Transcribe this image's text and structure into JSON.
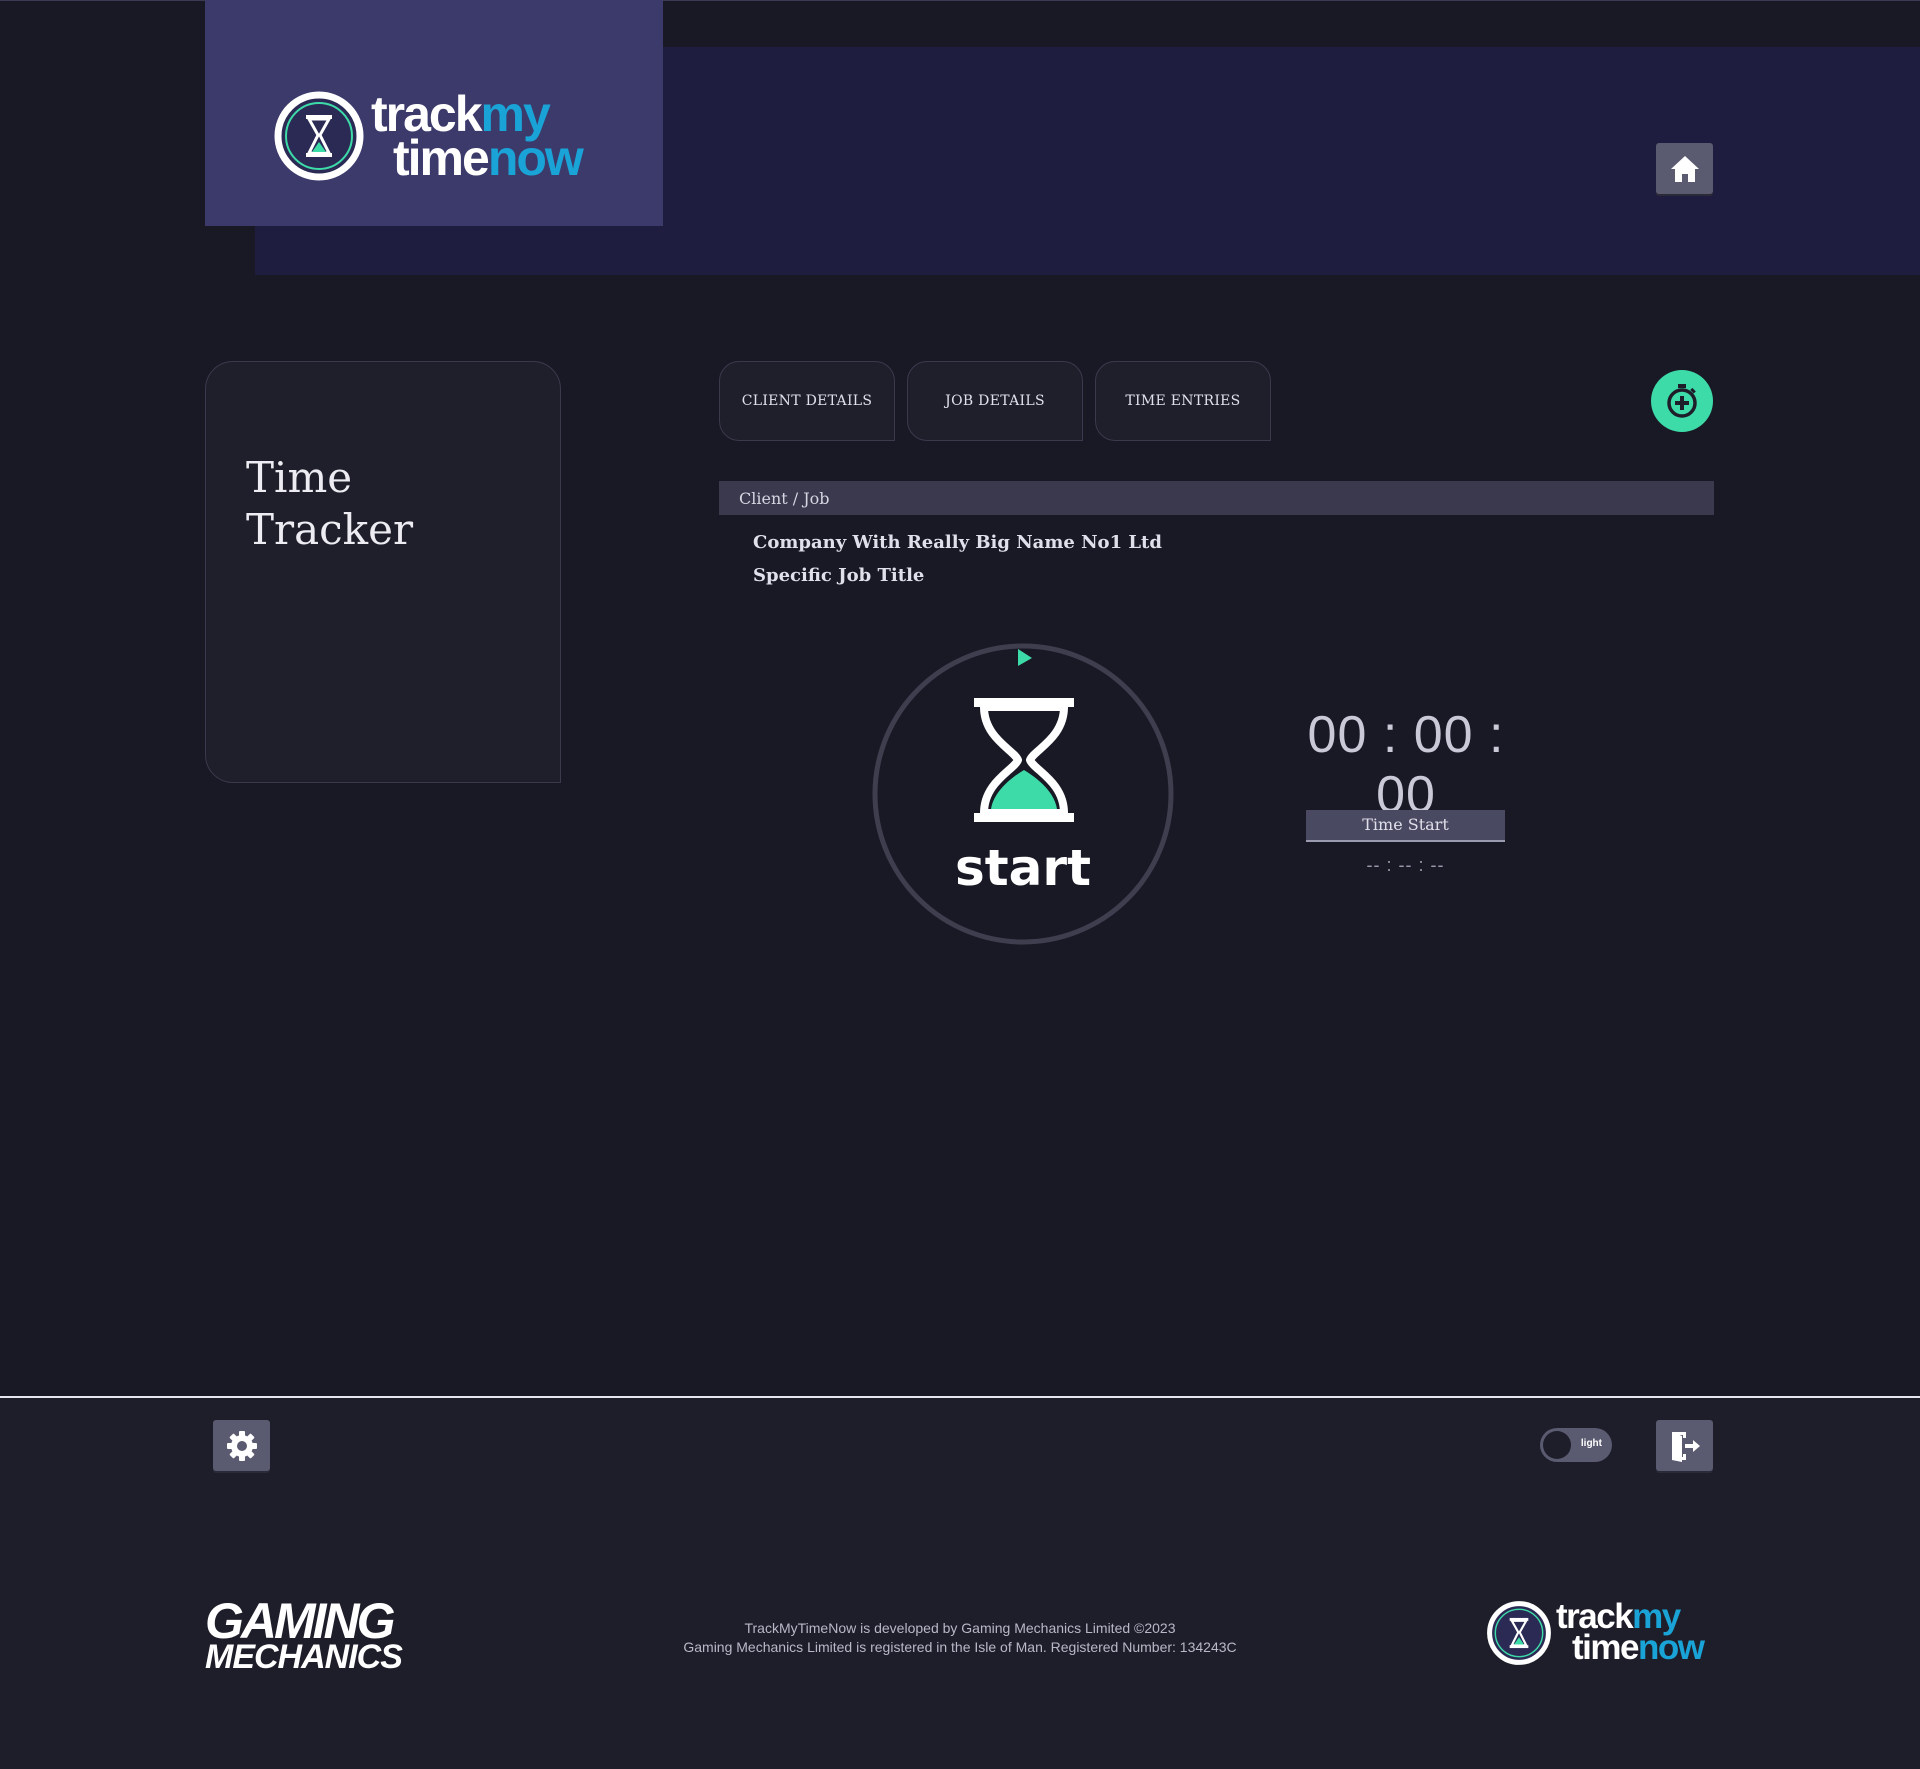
{
  "header": {
    "logo": {
      "word1": "track",
      "word2": "my",
      "word3": "time",
      "word4": "now"
    },
    "home_icon": "home-icon"
  },
  "sidebar": {
    "title": "Time\nTracker"
  },
  "tabs": [
    {
      "label": "CLIENT DETAILS"
    },
    {
      "label": "JOB DETAILS"
    },
    {
      "label": "TIME ENTRIES"
    }
  ],
  "add_timer_icon": "stopwatch-plus-icon",
  "client_job": {
    "heading": "Client / Job",
    "client_name": "Company With Really Big Name No1 Ltd",
    "job_title": "Specific Job Title"
  },
  "timer": {
    "start_label": "start",
    "elapsed": "00 : 00 : 00",
    "time_start_label": "Time Start",
    "time_start_value": "-- : -- : --"
  },
  "footer": {
    "settings_icon": "gear-icon",
    "theme_toggle_label": "light",
    "logout_icon": "logout-door-icon",
    "brand_line1": "GAMING",
    "brand_line2": "MECHANICS",
    "legal_line1": "TrackMyTimeNow is developed by Gaming Mechanics Limited ©2023",
    "legal_line2": "Gaming Mechanics Limited is registered in the Isle of Man. Registered Number: 134243C"
  },
  "colors": {
    "accent": "#3ddba8",
    "brand_blue": "#1aa3d6",
    "background": "#191926",
    "header_band": "#1e1d3f",
    "logo_panel": "#3c3a6b"
  }
}
